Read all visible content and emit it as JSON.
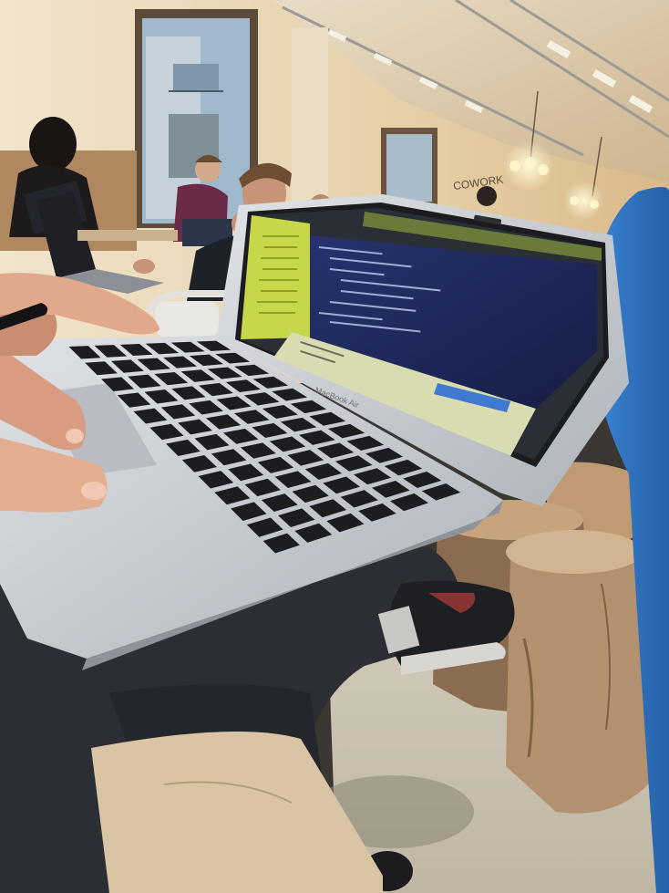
{
  "scene": {
    "wall_sign": "COWORK",
    "laptop_brand": "MacBook Air"
  },
  "colors": {
    "wall": "#e8d6b4",
    "ceiling": "#d8c3a0",
    "window_sky": "#9fb8cc",
    "laptop_silver": "#c9cdd3",
    "keyboard_key": "#1c1d20",
    "screen_editor_bg": "#1f2a5a",
    "screen_sidebar": "#c8d64a",
    "screen_panel": "#d9dcb0",
    "jeans": "#2b2e35",
    "blue_sleeve": "#2f78c9",
    "wood_stump": "#b08a63",
    "floor": "#cfc7b6"
  }
}
